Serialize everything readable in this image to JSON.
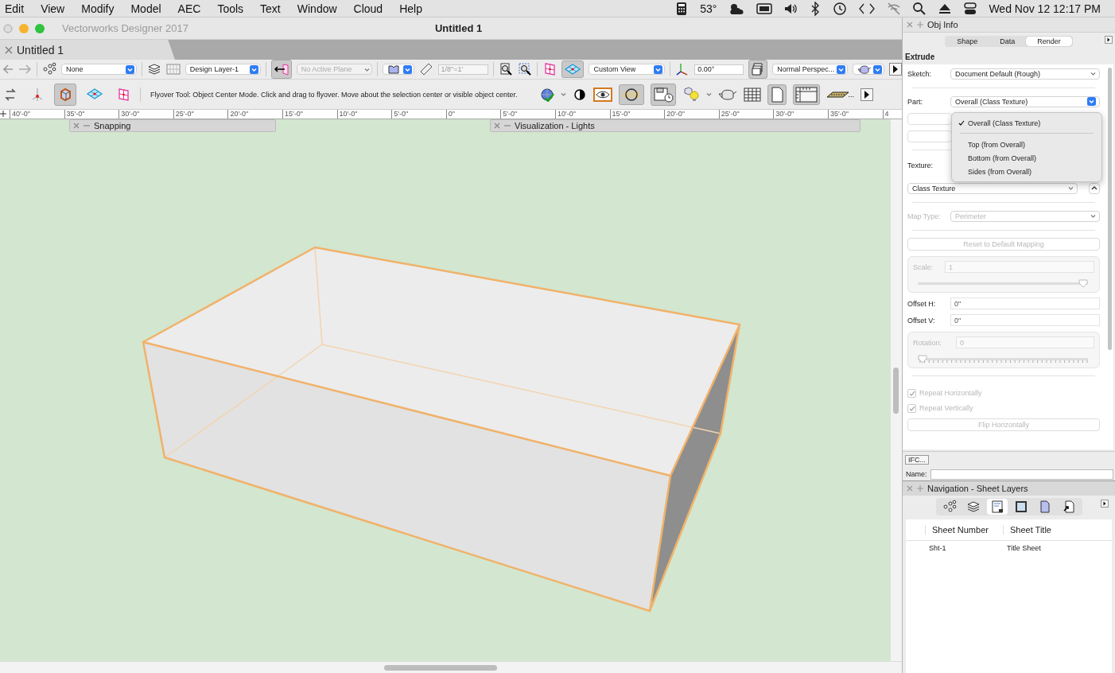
{
  "menu_bar": {
    "menus": [
      "Edit",
      "View",
      "Modify",
      "Model",
      "AEC",
      "Tools",
      "Text",
      "Window",
      "Cloud",
      "Help"
    ],
    "temperature": "53°",
    "clock": "Wed Nov 12  12:17 PM"
  },
  "window": {
    "app_title": "Vectorworks Designer 2017",
    "title": "Untitled 1"
  },
  "tabs": [
    {
      "label": "Untitled 1",
      "selected": true
    }
  ],
  "view_bar": {
    "class": "None",
    "layer": "Design Layer-1",
    "plane": "No Active Plane",
    "plane_disabled": true,
    "scale": "1/8\"=1'",
    "view": "Custom View",
    "rotation": "0.00°",
    "projection": "Normal Perspec..."
  },
  "mode_bar": {
    "modes": [
      {
        "selected": false
      },
      {
        "selected": false
      },
      {
        "selected": true
      },
      {
        "selected": false
      },
      {
        "selected": false
      }
    ],
    "help_text": "Flyover Tool: Object Center Mode. Click and drag to flyover.  Move about the selection center or visible object center.",
    "more": "..."
  },
  "ruler": {
    "labels": [
      "40'-0\"",
      "35'-0\"",
      "30'-0\"",
      "25'-0\"",
      "20'-0\"",
      "15'-0\"",
      "10'-0\"",
      "5'-0\"",
      "0\"",
      "5'-0\"",
      "10'-0\"",
      "15'-0\"",
      "20'-0\"",
      "25'-0\"",
      "30'-0\"",
      "35'-0\"",
      "4"
    ]
  },
  "palettes": [
    {
      "title": "Snapping"
    },
    {
      "title": "Visualization - Lights"
    }
  ],
  "obj_info": {
    "title": "Obj Info",
    "tabs": [
      {
        "label": "Shape",
        "selected": false
      },
      {
        "label": "Data",
        "selected": false
      },
      {
        "label": "Render",
        "selected": true
      }
    ],
    "object_type": "Extrude",
    "sketch": {
      "label": "Sketch:",
      "value": "Document Default (Rough)"
    },
    "part": {
      "label": "Part:",
      "value": "Overall (Class Texture)"
    },
    "part_menu": [
      {
        "label": "Overall (Class Texture)",
        "checked": true
      },
      {
        "label": "Top (from Overall)",
        "checked": false
      },
      {
        "label": "Bottom (from Overall)",
        "checked": false
      },
      {
        "label": "Sides (from Overall)",
        "checked": false
      }
    ],
    "texture_label": "Texture:",
    "texture": "Class Texture",
    "map_type": {
      "label": "Map Type:",
      "value": "Perimeter",
      "disabled": true
    },
    "reset_button": {
      "label": "Reset to Default Mapping",
      "disabled": true
    },
    "scale": {
      "label": "Scale:",
      "value": "1",
      "level": 1,
      "disabled": true
    },
    "offset_h": {
      "label": "Offset H:",
      "value": "0\""
    },
    "offset_v": {
      "label": "Offset V:",
      "value": "0\""
    },
    "rotation": {
      "label": "Rotation:",
      "value": "0",
      "level": 0,
      "disabled": true
    },
    "repeat": [
      {
        "label": "Repeat Horizontally",
        "checked": true,
        "disabled": true
      },
      {
        "label": "Repeat Vertically",
        "checked": true,
        "disabled": true
      }
    ],
    "flip_button": {
      "label": "Flip Horizontally",
      "disabled": true
    },
    "ifc_button": "IFC...",
    "name_label": "Name:"
  },
  "navigation": {
    "title": "Navigation - Sheet Layers",
    "tools": [
      {
        "selected": false
      },
      {
        "selected": false
      },
      {
        "selected": true
      },
      {
        "selected": false
      },
      {
        "selected": false
      },
      {
        "selected": false
      }
    ],
    "columns": [
      "Sheet Number",
      "Sheet Title"
    ],
    "rows": [
      [
        "Sht-1",
        "Title Sheet"
      ]
    ]
  }
}
